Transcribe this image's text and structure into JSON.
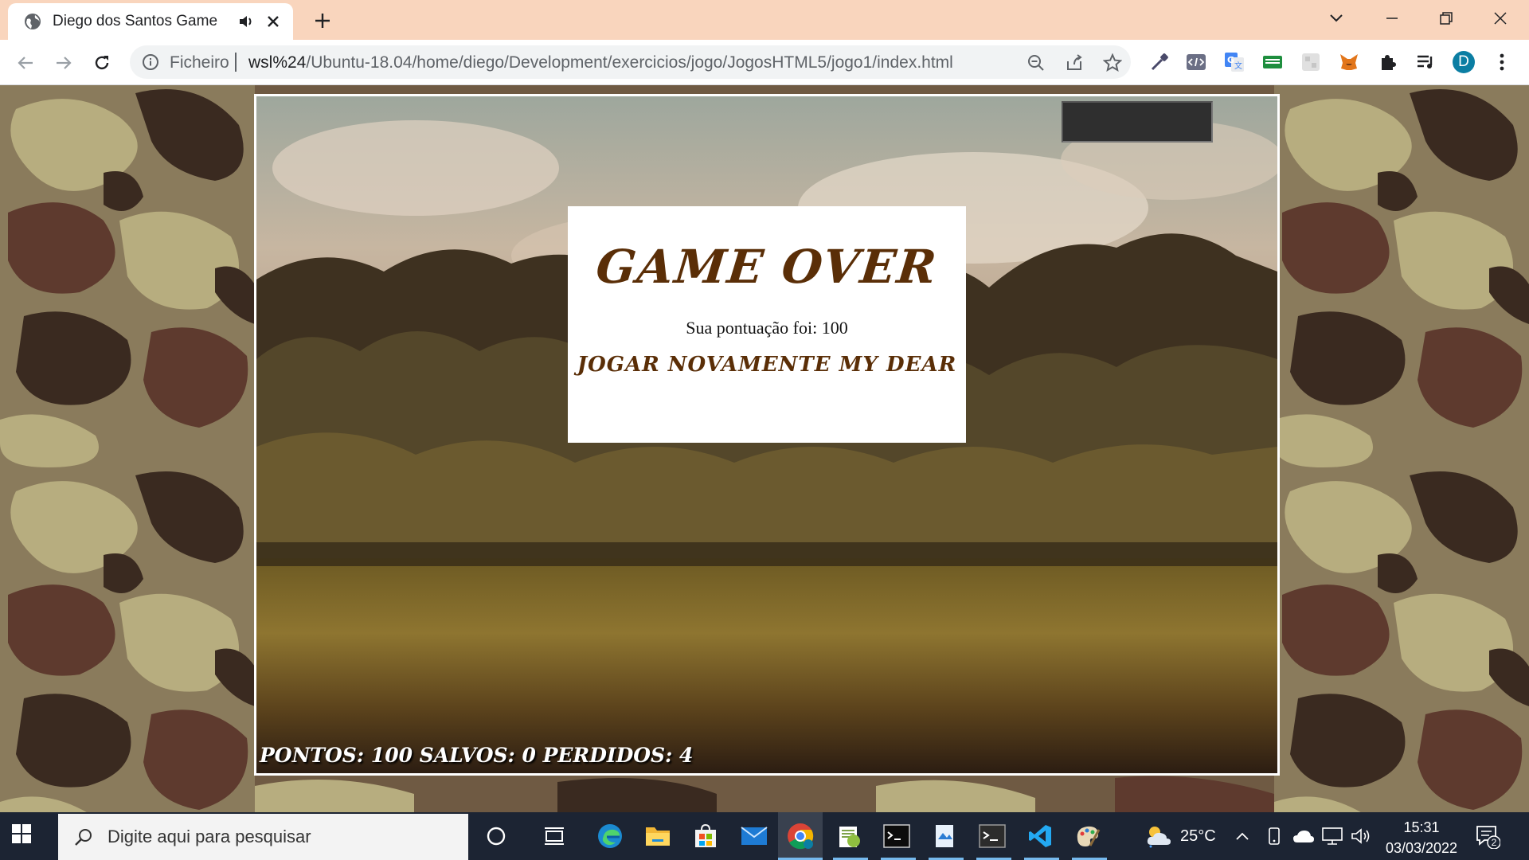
{
  "browser": {
    "tab_title": "Diego dos Santos Game",
    "address_scheme": "Ficheiro",
    "address_host": "wsl%24",
    "address_path": "/Ubuntu-18.04/home/diego/Development/exercicios/jogo/JogosHTML5/jogo1/index.html",
    "profile_initial": "D"
  },
  "game": {
    "gameover_title": "GAME OVER",
    "score_message": "Sua pontuação foi: 100",
    "replay_label": "JOGAR NOVAMENTE MY DEAR",
    "score_line": "PONTOS: 100 SALVOS: 0 PERDIDOS: 4"
  },
  "taskbar": {
    "search_placeholder": "Digite aqui para pesquisar",
    "temperature": "25°C",
    "time": "15:31",
    "date": "03/03/2022",
    "notification_count": "2"
  },
  "colors": {
    "tab_strip": "#f9d5bd",
    "gameover_brown": "#5a2e07",
    "taskbar": "#1c2433"
  }
}
